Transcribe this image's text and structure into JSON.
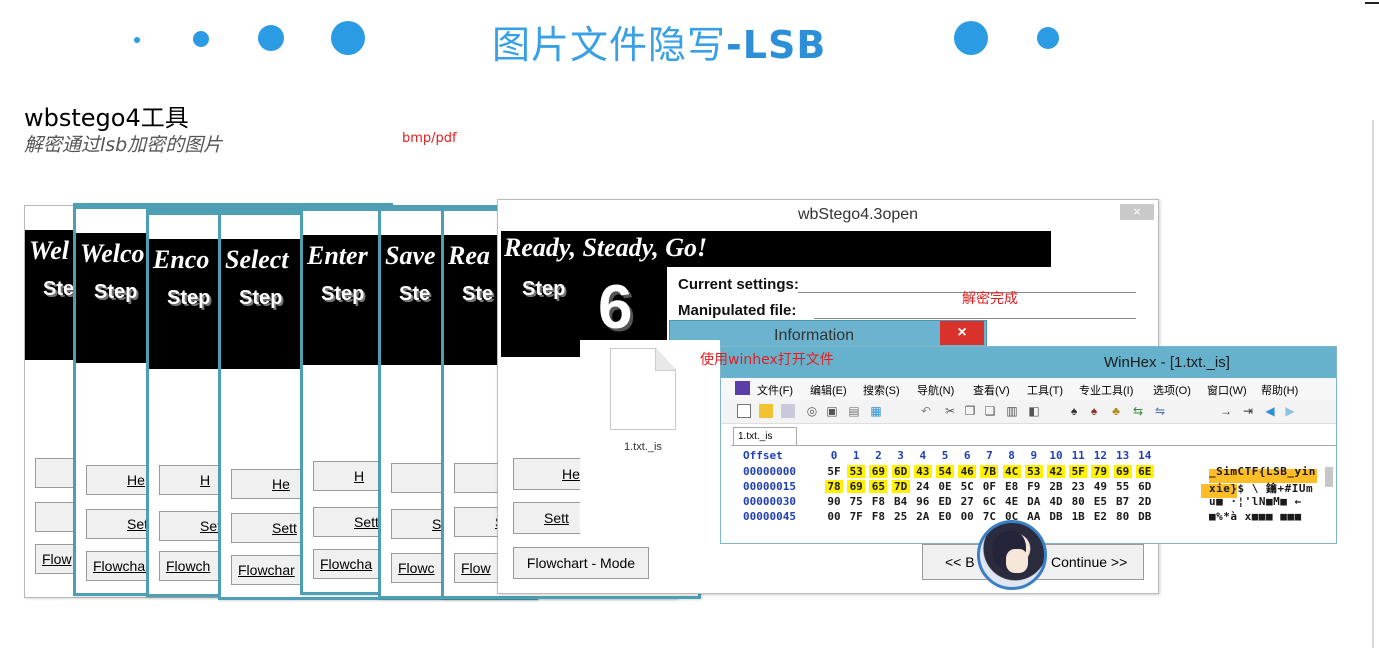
{
  "slide": {
    "title_cn": "图片文件隐写",
    "title_en": "-LSB",
    "tool_title": "wbstego4工具",
    "tool_subtitle": "解密通过lsb加密的图片",
    "note_formats": "bmp/pdf",
    "note_done": "解密完成",
    "note_winhex": "使用winhex打开文件",
    "accent_color": "#2b9be3"
  },
  "wizard_stack": [
    {
      "title": "Wel",
      "step": "Ste",
      "help": "",
      "settings": "",
      "flow": "Flow"
    },
    {
      "title": "Welco",
      "step": "Step",
      "help": "He",
      "settings": "Sett",
      "flow": "Flowchar"
    },
    {
      "title": "Enco",
      "step": "Step",
      "help": "H",
      "settings": "Set",
      "flow": "Flowch"
    },
    {
      "title": "Select",
      "step": "Step",
      "help": "He",
      "settings": "Sett",
      "flow": "Flowchar"
    },
    {
      "title": "Enter",
      "step": "Step",
      "help": "H",
      "settings": "Sett",
      "flow": "Flowcha"
    },
    {
      "title": "Save",
      "step": "Ste",
      "help": "",
      "settings": "Se",
      "flow": "Flowc"
    },
    {
      "title": "Rea",
      "step": "Ste",
      "help": "",
      "settings": "S",
      "flow": "Flow"
    }
  ],
  "front_wizard": {
    "window_title": "wbStego4.3open",
    "close_label": "×",
    "banner_title": "Ready, Steady, Go!",
    "step_label": "Step",
    "step_number": "6",
    "current_settings": "Current settings:",
    "manipulated_file": "Manipulated file:",
    "help_label": "He",
    "settings_label": "Sett",
    "flowchart_button": "Flowchart - Mode",
    "back_button": "<< B",
    "continue_button": "Continue >>"
  },
  "info_dialog": {
    "title": "Information",
    "close_label": "×"
  },
  "file_panel": {
    "filename": "1.txt._is"
  },
  "winhex": {
    "window_title": "WinHex - [1.txt._is]",
    "menu": [
      "文件(F)",
      "编辑(E)",
      "搜索(S)",
      "导航(N)",
      "查看(V)",
      "工具(T)",
      "专业工具(I)",
      "选项(O)",
      "窗口(W)",
      "帮助(H)"
    ],
    "tab_label": "1.txt._is",
    "offset_header": "Offset",
    "column_headers": [
      "0",
      "1",
      "2",
      "3",
      "4",
      "5",
      "6",
      "7",
      "8",
      "9",
      "10",
      "11",
      "12",
      "13",
      "14"
    ],
    "rows": [
      {
        "offset": "00000000",
        "bytes": [
          "5F",
          "53",
          "69",
          "6D",
          "43",
          "54",
          "46",
          "7B",
          "4C",
          "53",
          "42",
          "5F",
          "79",
          "69",
          "6E"
        ],
        "ascii": "_SimCTF{LSB_yin"
      },
      {
        "offset": "00000015",
        "bytes": [
          "78",
          "69",
          "65",
          "7D",
          "24",
          "0E",
          "5C",
          "0F",
          "E8",
          "F9",
          "2B",
          "23",
          "49",
          "55",
          "6D"
        ],
        "ascii": "xie}$ \\ 鑰+#IUm"
      },
      {
        "offset": "00000030",
        "bytes": [
          "90",
          "75",
          "F8",
          "B4",
          "96",
          "ED",
          "27",
          "6C",
          "4E",
          "DA",
          "4D",
          "80",
          "E5",
          "B7",
          "2D"
        ],
        "ascii": "u■ ·¦'lN■M■ ←"
      },
      {
        "offset": "00000045",
        "bytes": [
          "00",
          "7F",
          "F8",
          "25",
          "2A",
          "E0",
          "00",
          "7C",
          "0C",
          "AA",
          "DB",
          "1B",
          "E2",
          "80",
          "DB"
        ],
        "ascii": "■%*à x■■■ ■■■"
      }
    ],
    "highlight_color": "#fff100"
  }
}
